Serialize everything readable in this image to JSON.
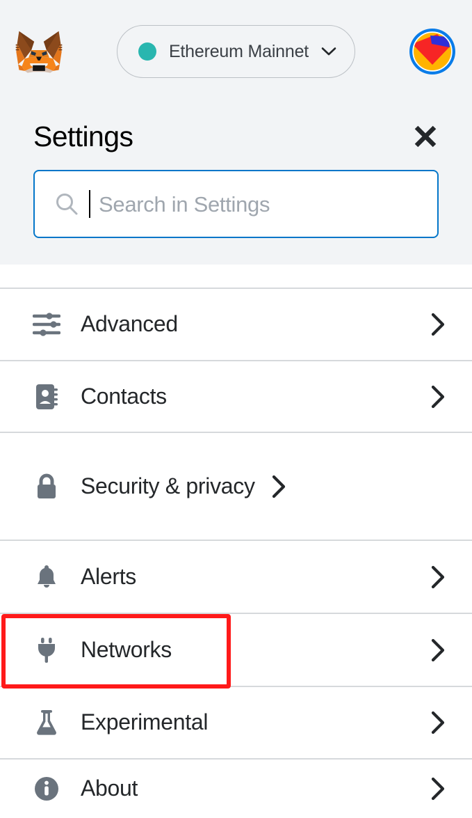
{
  "appbar": {
    "logo_icon": "metamask-fox-logo",
    "network": {
      "name": "Ethereum Mainnet",
      "dot_color": "#29b6af",
      "chevron_icon": "chevron-down-icon"
    },
    "account_avatar_icon": "account-identicon"
  },
  "settings_header": {
    "title": "Settings",
    "close_icon": "close-icon",
    "search": {
      "icon": "search-icon",
      "value": "",
      "placeholder": "Search in Settings",
      "border_color": "#0376c9",
      "caret_visible": true
    }
  },
  "settings_list": {
    "items": [
      {
        "label": "",
        "icon": "general-icon",
        "chevron": "chevron-right-icon",
        "partial": true
      },
      {
        "label": "Advanced",
        "icon": "sliders-icon",
        "chevron": "chevron-right-icon"
      },
      {
        "label": "Contacts",
        "icon": "address-book-icon",
        "chevron": "chevron-right-icon"
      },
      {
        "label": "Security & privacy",
        "icon": "lock-icon",
        "chevron": "chevron-right-icon"
      },
      {
        "label": "Alerts",
        "icon": "bell-icon",
        "chevron": "chevron-right-icon"
      },
      {
        "label": "Networks",
        "icon": "plug-icon",
        "chevron": "chevron-right-icon",
        "highlighted": true
      },
      {
        "label": "Experimental",
        "icon": "flask-icon",
        "chevron": "chevron-right-icon"
      },
      {
        "label": "About",
        "icon": "info-circle-icon",
        "chevron": "chevron-right-icon"
      }
    ]
  },
  "annotation": {
    "highlight_color": "#ff1a1a",
    "target": "Networks"
  },
  "colors": {
    "header_bg": "#f2f4f6",
    "icon_gray": "#6a737d",
    "text_primary": "#24272a",
    "divider": "#d6d9dc",
    "accent_blue": "#0376c9"
  }
}
